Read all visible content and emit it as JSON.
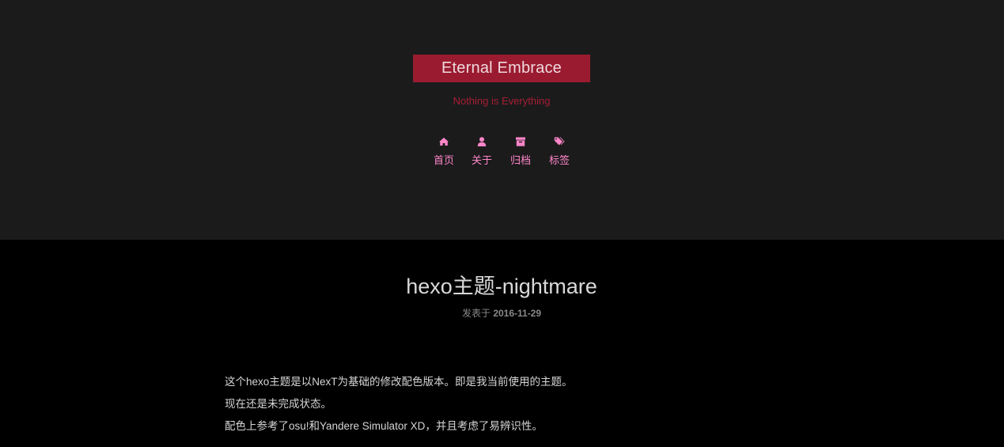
{
  "site": {
    "title": "Eternal Embrace",
    "subtitle": "Nothing is Everything"
  },
  "nav": {
    "items": [
      {
        "label": "首页",
        "icon": "home-icon"
      },
      {
        "label": "关于",
        "icon": "user-icon"
      },
      {
        "label": "归档",
        "icon": "archive-icon"
      },
      {
        "label": "标签",
        "icon": "tags-icon"
      }
    ]
  },
  "post": {
    "title": "hexo主题-nightmare",
    "meta_prefix": "发表于",
    "date": "2016-11-29",
    "paragraphs": [
      "这个hexo主题是以NexT为基础的修改配色版本。即是我当前使用的主题。",
      "现在还是未完成状态。",
      "配色上参考了osu!和Yandere Simulator XD，并且考虑了易辨识性。"
    ]
  },
  "colors": {
    "header_bg": "#1b1b1c",
    "page_bg": "#000000",
    "brand_bg": "#9a1b30",
    "subtitle": "#a81d33",
    "nav_accent": "#ff86c8",
    "text": "#d6d6d6"
  }
}
